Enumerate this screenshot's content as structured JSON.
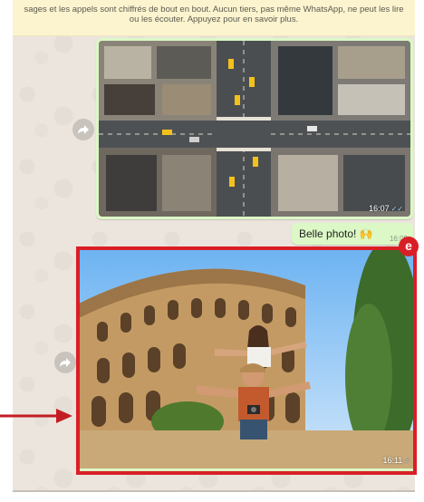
{
  "notice": {
    "text": "sages et les appels sont chiffrés de bout en bout. Aucun tiers, pas même WhatsApp, ne peut les lire ou les écouter. Appuyez pour en savoir plus."
  },
  "messages": [
    {
      "type": "image",
      "direction": "outgoing",
      "time": "16:07",
      "ticks": "✓✓",
      "description_icon": "city-aerial-photo"
    },
    {
      "type": "text",
      "direction": "outgoing",
      "text": "Belle photo! 🙌",
      "time": "16:09"
    },
    {
      "type": "image",
      "direction": "outgoing",
      "time": "16:11",
      "ticks": "✓",
      "description_icon": "colosseum-photo"
    }
  ],
  "annotation": {
    "badge_letter": "e",
    "highlight_color": "#d91f26"
  },
  "colors": {
    "chat_background": "#ece5dd",
    "outgoing_bubble": "#dcf8c6",
    "notice_background": "#fcf3cf"
  }
}
